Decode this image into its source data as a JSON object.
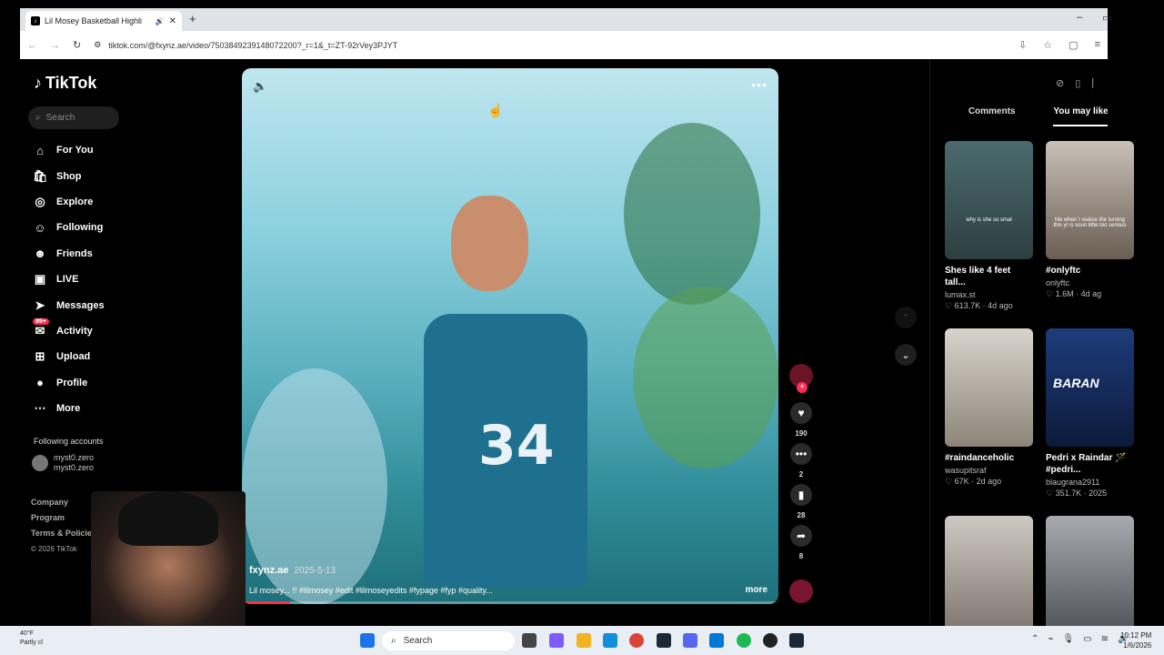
{
  "browser": {
    "tab_title": "Lil Mosey Basketball Highli",
    "url": "tiktok.com/@fxynz.ae/video/7503849239148072200?_r=1&_t=ZT-92rVey3PJYT"
  },
  "sidebar": {
    "logo": "TikTok",
    "search_placeholder": "Search",
    "items": [
      {
        "label": "For You",
        "icon": "home-icon"
      },
      {
        "label": "Shop",
        "icon": "bag-icon"
      },
      {
        "label": "Explore",
        "icon": "compass-icon"
      },
      {
        "label": "Following",
        "icon": "person-icon"
      },
      {
        "label": "Friends",
        "icon": "friends-icon"
      },
      {
        "label": "LIVE",
        "icon": "live-icon"
      },
      {
        "label": "Messages",
        "icon": "send-icon"
      },
      {
        "label": "Activity",
        "icon": "inbox-icon",
        "badge": "99+"
      },
      {
        "label": "Upload",
        "icon": "plus-square-icon"
      },
      {
        "label": "Profile",
        "icon": "avatar-icon"
      },
      {
        "label": "More",
        "icon": "more-icon"
      }
    ],
    "following_header": "Following accounts",
    "following": [
      {
        "name": "myst0.zero",
        "handle": "myst0.zero"
      }
    ],
    "footer": [
      "Company",
      "Program",
      "Terms & Policies"
    ],
    "copyright": "© 2026 TikTok"
  },
  "video": {
    "author": "fxynz.ae",
    "date": "2025-5-13",
    "caption": "Lil mosey... !! #lilmosey #edit #lilmoseyedits #fypage #fyp #quality...",
    "more_label": "more",
    "progress": 0.09
  },
  "actions": {
    "likes": "190",
    "comments": "2",
    "saves": "28",
    "shares": "8"
  },
  "right_panel": {
    "tabs": [
      "Comments",
      "You may like"
    ],
    "cards": [
      {
        "caption": "Shes like 4 feet tall...",
        "user": "lumax.st",
        "likes": "613.7K",
        "age": "4d ago",
        "overlay": "why is she so smal"
      },
      {
        "caption": "#onlyftc",
        "user": "onlyftc",
        "likes": "1.6M",
        "age": "4d ag",
        "overlay": "Me when I realize the turning this yr is soun little too serious"
      },
      {
        "caption": "#raindanceholic",
        "user": "wasupitsraf",
        "likes": "67K",
        "age": "2d ago",
        "overlay": ""
      },
      {
        "caption": "Pedri x Raindar 🪄 #pedri...",
        "user": "blaugrana2911",
        "likes": "351.7K",
        "age": "2025",
        "overlay": "BARAN"
      },
      {
        "caption": "",
        "user": "",
        "likes": "",
        "age": "",
        "overlay": ""
      },
      {
        "caption": "",
        "user": "",
        "likes": "",
        "age": "",
        "overlay": ""
      }
    ]
  },
  "taskbar": {
    "temp": "40°F",
    "weather": "Partly cl",
    "search": "Search",
    "time": "10:12 PM",
    "date": "1/6/2026"
  }
}
